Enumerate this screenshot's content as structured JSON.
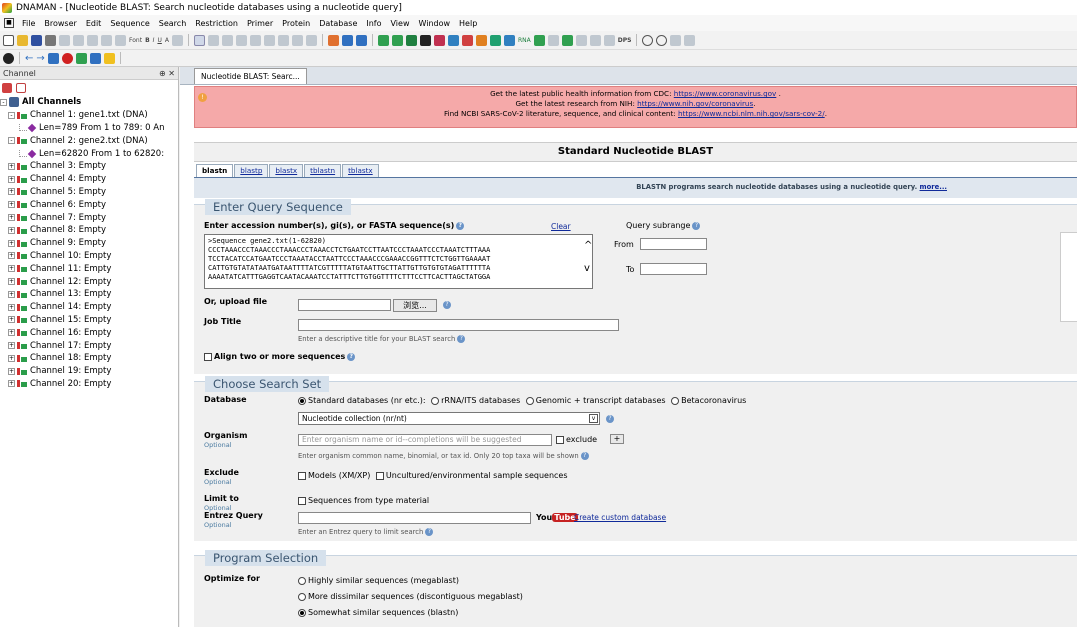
{
  "titlebar": {
    "title": "DNAMAN - [Nucleotide BLAST: Search nucleotide databases using a nucleotide query]"
  },
  "menu": [
    "File",
    "Browser",
    "Edit",
    "Sequence",
    "Search",
    "Restriction",
    "Primer",
    "Protein",
    "Database",
    "Info",
    "View",
    "Window",
    "Help"
  ],
  "toolbar": {
    "font_label": "Font",
    "rna_label": "RNA",
    "dps_label": "DPS"
  },
  "sidebar": {
    "header": "Channel",
    "pin": "⊕ ✕",
    "root": "All Channels",
    "ch1": "Channel 1: gene1.txt (DNA)",
    "ch1_info": "Len=789 From 1 to 789: 0 An",
    "ch2": "Channel 2: gene2.txt (DNA)",
    "ch2_info": "Len=62820 From 1 to 62820:",
    "empty": [
      "Channel 3: Empty",
      "Channel 4: Empty",
      "Channel 5: Empty",
      "Channel 6: Empty",
      "Channel 7: Empty",
      "Channel 8: Empty",
      "Channel 9: Empty",
      "Channel 10: Empty",
      "Channel 11: Empty",
      "Channel 12: Empty",
      "Channel 13: Empty",
      "Channel 14: Empty",
      "Channel 15: Empty",
      "Channel 16: Empty",
      "Channel 17: Empty",
      "Channel 18: Empty",
      "Channel 19: Empty",
      "Channel 20: Empty"
    ]
  },
  "browser": {
    "tab": "Nucleotide BLAST: Searc...",
    "alert": {
      "l1a": "Get the latest public health information from CDC: ",
      "l1b": "https://www.coronavirus.gov",
      "l1c": " .",
      "l2a": "Get the latest research from NIH: ",
      "l2b": "https://www.nih.gov/coronavirus",
      "l2c": ".",
      "l3a": "Find NCBI SARS-CoV-2 literature, sequence, and clinical content: ",
      "l3b": "https://www.ncbi.nlm.nih.gov/sars-cov-2/",
      "l3c": "."
    },
    "page_title": "Standard Nucleotide BLAST",
    "tabs": [
      "blastn",
      "blastp",
      "blastx",
      "tblastn",
      "tblastx"
    ],
    "info": "BLASTN programs search nucleotide databases using a nucleotide query.",
    "more": "more...",
    "query": {
      "heading": "Enter Query Sequence",
      "label": "Enter accession number(s), gi(s), or FASTA sequence(s)",
      "clear": "Clear",
      "subrange": "Query subrange",
      "from": "From",
      "to": "To",
      "seq": ">Sequence gene2.txt(1-62820)\nCCCTAAACCCTAAACCCTAAACCCTAAACCTCTGAATCCTTAATCCCTAAATCCCTAAATCTTTAAA\nTCCTACATCCATGAATCCCTAAATACCTAATTCCCTAAACCCGAAACCGGTTTCTCTGGTTGAAAAT\nCATTGTGTATATAATGATAATTTTATCGTTTTTATGTAATTGCTTATTGTTGTGTGTAGATTTTTTA\nAAAATATCATTTGAGGTCAATACAAATCCTATTTCTTGTGGTTTTCTTTCCTTCACTTAGCTATGGA",
      "upload_label": "Or, upload file",
      "browse": "浏览...",
      "job_label": "Job Title",
      "job_hint": "Enter a descriptive title for your BLAST search",
      "align": "Align two or more sequences"
    },
    "search": {
      "heading": "Choose Search Set",
      "db_label": "Database",
      "db_opts": [
        "Standard databases (nr etc.):",
        "rRNA/ITS databases",
        "Genomic + transcript databases",
        "Betacoronavirus"
      ],
      "db_select": "Nucleotide collection (nr/nt)",
      "org_label": "Organism",
      "optional": "Optional",
      "org_placeholder": "Enter organism name or id--completions will be suggested",
      "exclude_chk": "exclude",
      "org_hint": "Enter organism common name, binomial, or tax id. Only 20 top taxa will be shown",
      "excl_label": "Exclude",
      "excl_models": "Models (XM/XP)",
      "excl_unc": "Uncultured/environmental sample sequences",
      "limit_label": "Limit to",
      "limit_type": "Sequences from type material",
      "entrez_label": "Entrez Query",
      "yt_you": "You",
      "yt_tube": "Tube",
      "custom_db": "Create custom database",
      "entrez_hint": "Enter an Entrez query to limit search"
    },
    "program": {
      "heading": "Program Selection",
      "opt_label": "Optimize for",
      "opts": [
        "Highly similar sequences (megablast)",
        "More dissimilar sequences (discontiguous megablast)",
        "Somewhat similar sequences (blastn)"
      ]
    }
  }
}
